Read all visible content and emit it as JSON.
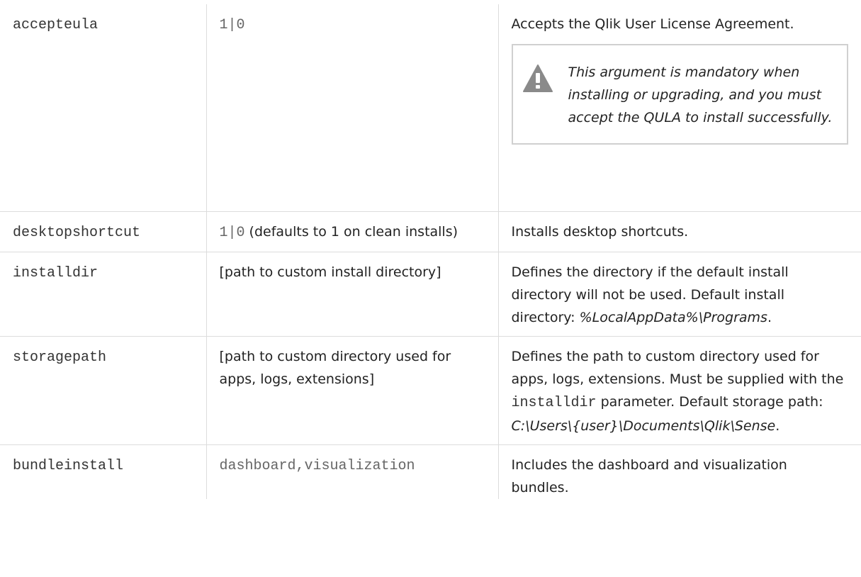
{
  "rows": [
    {
      "name": "accepteula",
      "value": "1|0",
      "description": "Accepts the Qlik User License Agreement.",
      "note": {
        "icon": "warning-icon",
        "text": "This argument is mandatory when installing or upgrading, and you must accept the QULA to install successfully."
      }
    },
    {
      "name": "desktopshortcut",
      "value_code": "1|0",
      "value_text": " (defaults to 1 on clean installs)",
      "description": "Installs desktop shortcuts."
    },
    {
      "name": "installdir",
      "value": "[path to custom install directory]",
      "description_before": "Defines the directory if the default install directory will not be used. Default install directory: ",
      "description_italic": "%LocalAppData%\\Programs",
      "description_after": "."
    },
    {
      "name": "storagepath",
      "value": "[path to custom directory used for apps, logs, extensions]",
      "description_before": "Defines the path to custom directory used for apps, logs, extensions. Must be supplied with the ",
      "description_code": "installdir",
      "description_mid": " parameter. Default storage path: ",
      "description_italic": "C:\\Users\\{user}\\Documents\\Qlik\\Sense",
      "description_after": "."
    },
    {
      "name": "bundleinstall",
      "value": "dashboard,visualization",
      "description": "Includes the dashboard and visualization bundles."
    }
  ],
  "colors": {
    "border": "#dcdcdc",
    "warning_icon": "#8a8a8a",
    "text": "#222222"
  }
}
